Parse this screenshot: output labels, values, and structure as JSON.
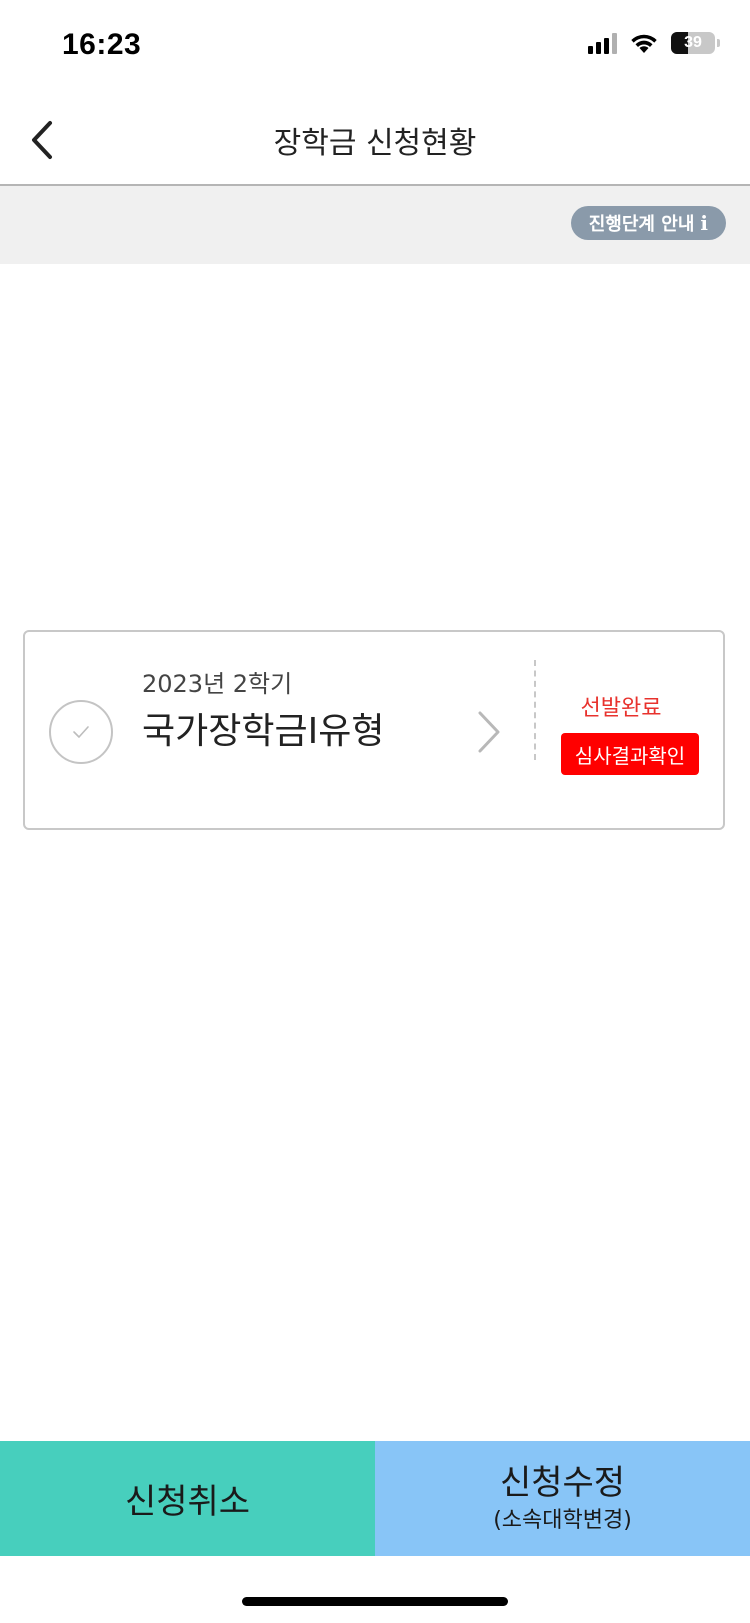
{
  "status_bar": {
    "time": "16:23",
    "battery_percent": "39",
    "battery_level": 0.39
  },
  "header": {
    "title": "장학금 신청현황"
  },
  "guide": {
    "label": "진행단계 안내",
    "info_symbol": "i"
  },
  "application": {
    "semester": "2023년 2학기",
    "name": "국가장학금I유형",
    "status": "선발완료",
    "result_button": "심사결과확인"
  },
  "actions": {
    "cancel": "신청취소",
    "modify": "신청수정",
    "modify_sub": "(소속대학변경)"
  },
  "colors": {
    "status_red": "#e8322d",
    "result_button_bg": "#ff0000",
    "cancel_bg": "#47cfbd",
    "modify_bg": "#88c5f7",
    "guide_bg": "#8a9aaa"
  },
  "icons": [
    "back-chevron-icon",
    "check-icon",
    "chevron-right-icon",
    "signal-icon",
    "wifi-icon",
    "battery-icon",
    "info-icon"
  ]
}
